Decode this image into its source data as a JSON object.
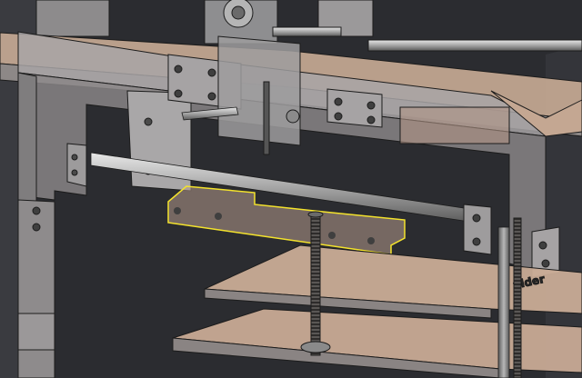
{
  "viewport": {
    "background": "#2b2c30",
    "colors": {
      "wood_top": "#c7a891",
      "wood_top_light": "#d3b7a2",
      "wood_front": "#8f8a88",
      "metal_light": "#c9c9c9",
      "metal_mid": "#9c9c9c",
      "metal_dark": "#6e6e6e",
      "edge": "#1c1c1c",
      "selection": "#f4e32c"
    },
    "icons": {
      "rod": "steel-rod",
      "leadscrew": "threaded-rod",
      "hole": "mount-hole"
    }
  },
  "bed_logo": {
    "text": "ulder"
  }
}
